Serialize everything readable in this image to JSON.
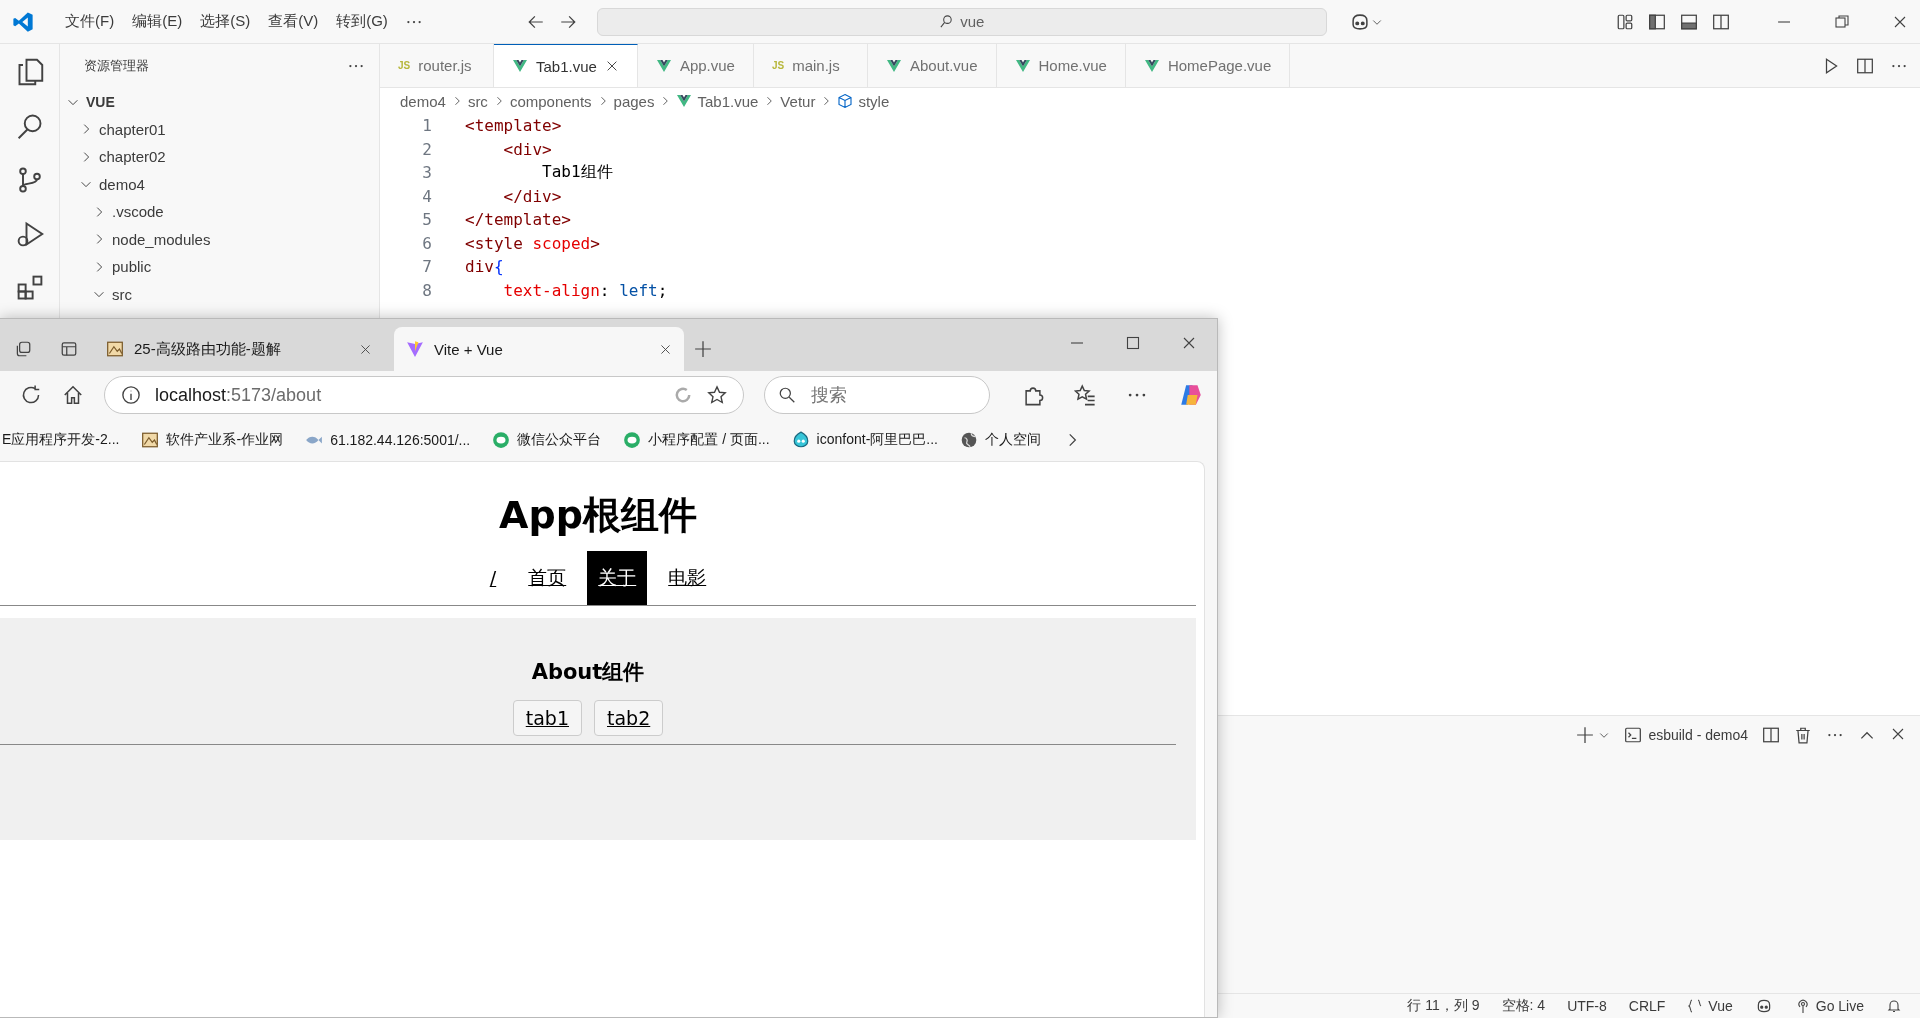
{
  "menu": [
    "文件(F)",
    "编辑(E)",
    "选择(S)",
    "查看(V)",
    "转到(G)"
  ],
  "command_center": {
    "value": "vue"
  },
  "explorer": {
    "title": "资源管理器",
    "tree": [
      {
        "label": "VUE",
        "expanded": true,
        "children": [
          {
            "label": "chapter01",
            "expanded": false
          },
          {
            "label": "chapter02",
            "expanded": false
          },
          {
            "label": "demo4",
            "expanded": true,
            "children": [
              {
                "label": ".vscode",
                "expanded": false
              },
              {
                "label": "node_modules",
                "expanded": false
              },
              {
                "label": "public",
                "expanded": false
              },
              {
                "label": "src",
                "expanded": true
              }
            ]
          }
        ]
      }
    ]
  },
  "editor_tabs": [
    {
      "label": "router.js",
      "kind": "js",
      "icon_text": "JS",
      "selected": false
    },
    {
      "label": "Tab1.vue",
      "kind": "vue",
      "selected": true
    },
    {
      "label": "App.vue",
      "kind": "vue",
      "selected": false
    },
    {
      "label": "main.js",
      "kind": "js",
      "icon_text": "JS",
      "selected": false
    },
    {
      "label": "About.vue",
      "kind": "vue",
      "selected": false
    },
    {
      "label": "Home.vue",
      "kind": "vue",
      "selected": false
    },
    {
      "label": "HomePage.vue",
      "kind": "vue",
      "selected": false
    }
  ],
  "breadcrumb": [
    {
      "label": "demo4",
      "kind": "plain"
    },
    {
      "label": "src",
      "kind": "plain"
    },
    {
      "label": "components",
      "kind": "plain"
    },
    {
      "label": "pages",
      "kind": "plain"
    },
    {
      "label": "Tab1.vue",
      "kind": "vue"
    },
    {
      "label": "Vetur",
      "kind": "plain"
    },
    {
      "label": "style",
      "kind": "symbol"
    }
  ],
  "code": [
    {
      "number": "1",
      "tokens": [
        {
          "text": "<template>",
          "kind": "tag"
        }
      ]
    },
    {
      "number": "2",
      "tokens": [
        {
          "text": "    <div>",
          "kind": "tag"
        }
      ]
    },
    {
      "number": "3",
      "tokens": [
        {
          "text": "        Tab1组件",
          "kind": "text"
        }
      ]
    },
    {
      "number": "4",
      "tokens": [
        {
          "text": "    </div>",
          "kind": "tag"
        }
      ]
    },
    {
      "number": "5",
      "tokens": [
        {
          "text": "</template>",
          "kind": "tag"
        }
      ]
    },
    {
      "number": "6",
      "tokens": [
        {
          "text": "<style",
          "kind": "tag"
        },
        {
          "text": " scoped",
          "kind": "attr"
        },
        {
          "text": ">",
          "kind": "tag"
        }
      ]
    },
    {
      "number": "7",
      "tokens": [
        {
          "text": "div",
          "kind": "tag"
        },
        {
          "text": "{",
          "kind": "brace"
        }
      ]
    },
    {
      "number": "8",
      "tokens": [
        {
          "text": "    text-align",
          "kind": "prop"
        },
        {
          "text": ": ",
          "kind": "text"
        },
        {
          "text": "left",
          "kind": "value"
        },
        {
          "text": ";",
          "kind": "text"
        }
      ]
    }
  ],
  "panel": {
    "terminal": "esbuild - demo4"
  },
  "status_bar": [
    {
      "text": "行 11，列 9",
      "kind": "text"
    },
    {
      "text": "空格: 4",
      "kind": "text"
    },
    {
      "text": "UTF-8",
      "kind": "text"
    },
    {
      "text": "CRLF",
      "kind": "text"
    },
    {
      "text": "Vue",
      "kind": "language"
    },
    {
      "kind": "copilot"
    },
    {
      "text": "Go Live",
      "kind": "live"
    },
    {
      "kind": "bell"
    }
  ],
  "browser": {
    "tabs": [
      {
        "label": "25-高级路由功能-题解",
        "kind": "image",
        "selected": false
      },
      {
        "label": "Vite + Vue",
        "kind": "vite",
        "selected": true
      }
    ],
    "address": {
      "host": "localhost",
      "path": ":5173/about"
    },
    "search": {
      "placeholder": "搜索"
    },
    "bookmarks": [
      {
        "label": "E应用程序开发-2...",
        "kind": "none"
      },
      {
        "label": "软件产业系-作业网",
        "kind": "image"
      },
      {
        "label": "61.182.44.126:5001/...",
        "kind": "fish"
      },
      {
        "label": "微信公众平台",
        "kind": "wechat"
      },
      {
        "label": "小程序配置 / 页面...",
        "kind": "wechat"
      },
      {
        "label": "iconfont-阿里巴巴...",
        "kind": "iconfont"
      },
      {
        "label": "个人空间",
        "kind": "globe"
      }
    ],
    "page": {
      "title": "App根组件",
      "nav": [
        {
          "label": "/",
          "selected": false
        },
        {
          "label": "首页",
          "selected": false
        },
        {
          "label": "关于",
          "selected": true
        },
        {
          "label": "电影",
          "selected": false
        }
      ],
      "section": {
        "title": "About组件",
        "buttons": [
          "tab1",
          "tab2"
        ]
      }
    }
  }
}
